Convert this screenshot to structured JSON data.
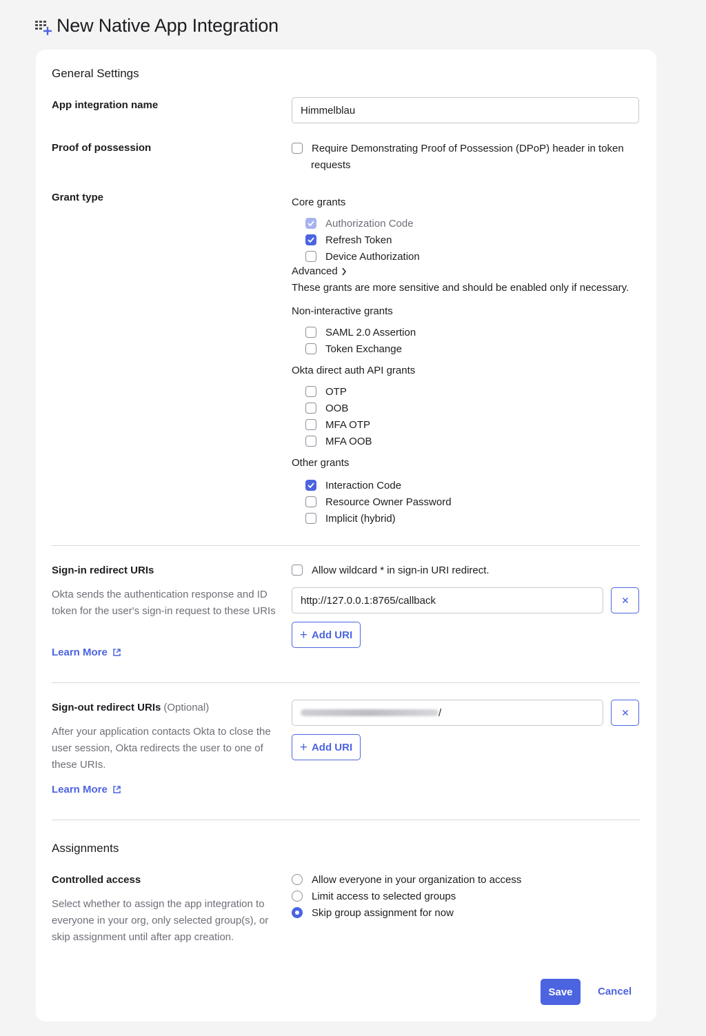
{
  "header": {
    "title": "New Native App Integration",
    "icon": "grid-plus-icon"
  },
  "general": {
    "title": "General Settings",
    "app_name_label": "App integration name",
    "app_name_value": "Himmelblau",
    "pop_label": "Proof of possession",
    "pop_line1": "Require Demonstrating Proof of Possession (DPoP) header in token",
    "pop_line2": "requests",
    "pop_checked": false,
    "grant_label": "Grant type",
    "core_title": "Core grants",
    "core": [
      {
        "label": "Authorization Code",
        "checked": true,
        "disabled": true
      },
      {
        "label": "Refresh Token",
        "checked": true
      },
      {
        "label": "Device Authorization",
        "checked": false
      }
    ],
    "advanced_label": "Advanced",
    "advanced_note": "These grants are more sensitive and should be enabled only if necessary.",
    "noninteractive_title": "Non-interactive grants",
    "noninteractive": [
      {
        "label": "SAML 2.0 Assertion",
        "checked": false
      },
      {
        "label": "Token Exchange",
        "checked": false
      }
    ],
    "direct_title": "Okta direct auth API grants",
    "direct": [
      {
        "label": "OTP",
        "checked": false
      },
      {
        "label": "OOB",
        "checked": false
      },
      {
        "label": "MFA OTP",
        "checked": false
      },
      {
        "label": "MFA OOB",
        "checked": false
      }
    ],
    "other_title": "Other grants",
    "other": [
      {
        "label": "Interaction Code",
        "checked": true
      },
      {
        "label": "Resource Owner Password",
        "checked": false
      },
      {
        "label": "Implicit (hybrid)",
        "checked": false
      }
    ]
  },
  "signin": {
    "label": "Sign-in redirect URIs",
    "help": "Okta sends the authentication response and ID token for the user's sign-in request to these URIs",
    "learn_more": "Learn More",
    "wildcard_label": "Allow wildcard * in sign-in URI redirect.",
    "uri_value": "http://127.0.0.1:8765/callback",
    "add_uri": "Add URI"
  },
  "signout": {
    "label": "Sign-out redirect URIs",
    "optional": "(Optional)",
    "help": "After your application contacts Okta to close the user session, Okta redirects the user to one of these URIs.",
    "learn_more": "Learn More",
    "uri_suffix": "/",
    "add_uri": "Add URI"
  },
  "assignments": {
    "title": "Assignments",
    "controlled_label": "Controlled access",
    "help": "Select whether to assign the app integration to everyone in your org, only selected group(s), or skip assignment until after app creation.",
    "options": [
      {
        "label": "Allow everyone in your organization to access",
        "selected": false
      },
      {
        "label": "Limit access to selected groups",
        "selected": false
      },
      {
        "label": "Skip group assignment for now",
        "selected": true
      }
    ]
  },
  "footer": {
    "save": "Save",
    "cancel": "Cancel"
  },
  "colors": {
    "accent": "#4c64e0",
    "muted_text": "#6e6e78",
    "border": "#c6c6cd"
  }
}
